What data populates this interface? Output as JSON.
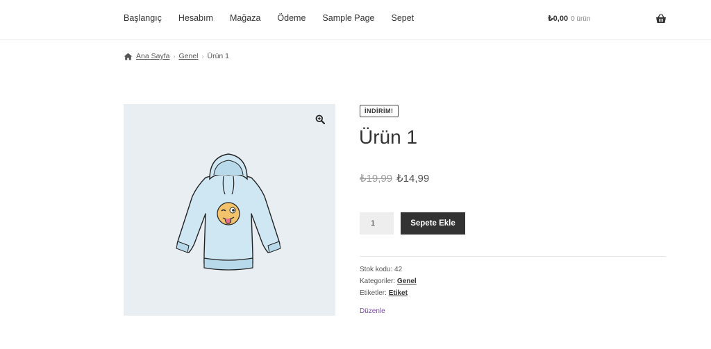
{
  "nav": {
    "items": [
      {
        "label": "Başlangıç"
      },
      {
        "label": "Hesabım"
      },
      {
        "label": "Mağaza"
      },
      {
        "label": "Ödeme"
      },
      {
        "label": "Sample Page"
      },
      {
        "label": "Sepet"
      }
    ]
  },
  "cart": {
    "amount": "₺0,00",
    "count": "0 ürün",
    "icon": "basket-icon"
  },
  "breadcrumb": {
    "home": "Ana Sayfa",
    "category": "Genel",
    "current": "Ürün 1",
    "separator": "›"
  },
  "product": {
    "badge": "İNDİRİM!",
    "title": "Ürün 1",
    "old_price": "₺19,99",
    "new_price": "₺14,99",
    "quantity": "1",
    "add_to_cart": "Sepete Ekle",
    "sku_label": "Stok kodu:",
    "sku_value": "42",
    "category_label": "Kategoriler:",
    "category_value": "Genel",
    "tags_label": "Etiketler:",
    "tags_value": "Etiket",
    "edit": "Düzenle",
    "image_icon": "hoodie-image",
    "zoom_icon": "zoom-in-icon"
  },
  "colors": {
    "button": "#333333",
    "gallery_bg": "#e9eef2",
    "hoodie": "#cfe7f3",
    "edit_link": "#7e4ea8"
  }
}
